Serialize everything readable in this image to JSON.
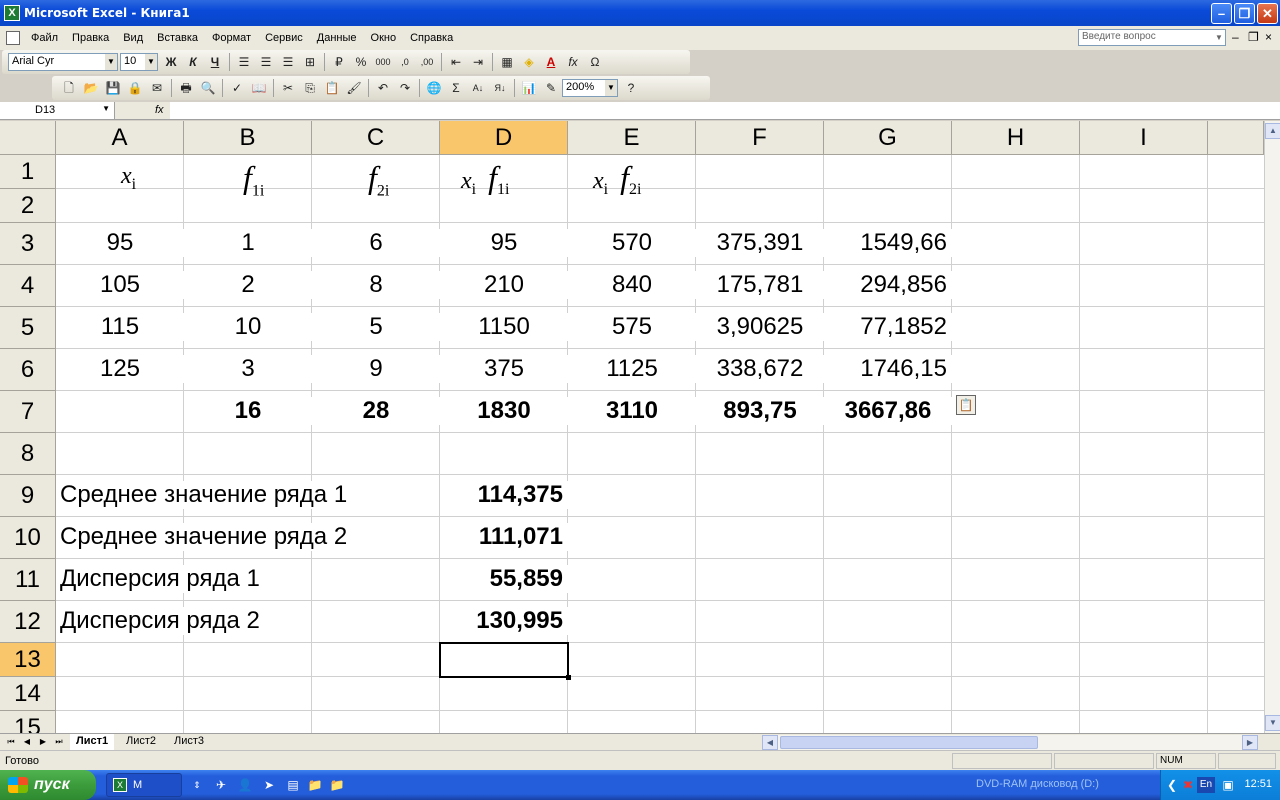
{
  "window": {
    "title": "Microsoft Excel - Книга1"
  },
  "menu": {
    "items": [
      "Файл",
      "Правка",
      "Вид",
      "Вставка",
      "Формат",
      "Сервис",
      "Данные",
      "Окно",
      "Справка"
    ],
    "ask_placeholder": "Введите вопрос"
  },
  "format_toolbar": {
    "font": "Arial Cyr",
    "size": "10",
    "bold": "Ж",
    "italic": "К",
    "underline": "Ч"
  },
  "standard_toolbar": {
    "zoom": "200%"
  },
  "formula_bar": {
    "name_box": "D13",
    "fx": "fx",
    "content": ""
  },
  "columns": [
    "A",
    "B",
    "C",
    "D",
    "E",
    "F",
    "G",
    "H",
    "I"
  ],
  "rows": [
    "1",
    "2",
    "3",
    "4",
    "5",
    "6",
    "7",
    "8",
    "9",
    "10",
    "11",
    "12",
    "13",
    "14",
    "15"
  ],
  "selected_cell": "D13",
  "header_formulas": {
    "a": {
      "var": "x",
      "sub": "i"
    },
    "b": {
      "var": "f",
      "sub": "1i"
    },
    "c": {
      "var": "f",
      "sub": "2i"
    },
    "d": {
      "var1": "x",
      "sub1": "i",
      "var2": "f",
      "sub2": "1i"
    },
    "e": {
      "var1": "x",
      "sub1": "i",
      "var2": "f",
      "sub2": "2i"
    }
  },
  "table": {
    "rows": [
      {
        "A": "95",
        "B": "1",
        "C": "6",
        "D": "95",
        "E": "570",
        "F": "375,391",
        "G": "1549,66"
      },
      {
        "A": "105",
        "B": "2",
        "C": "8",
        "D": "210",
        "E": "840",
        "F": "175,781",
        "G": "294,856"
      },
      {
        "A": "115",
        "B": "10",
        "C": "5",
        "D": "1150",
        "E": "575",
        "F": "3,90625",
        "G": "77,1852"
      },
      {
        "A": "125",
        "B": "3",
        "C": "9",
        "D": "375",
        "E": "1125",
        "F": "338,672",
        "G": "1746,15"
      }
    ],
    "totals": {
      "B": "16",
      "C": "28",
      "D": "1830",
      "E": "3110",
      "F": "893,75",
      "G": "3667,86"
    }
  },
  "stats": [
    {
      "label": "Среднее значение ряда 1",
      "value": "114,375"
    },
    {
      "label": "Среднее значение ряда 2",
      "value": "111,071"
    },
    {
      "label": "Дисперсия ряда 1",
      "value": "55,859"
    },
    {
      "label": "Дисперсия ряда 2",
      "value": "130,995"
    }
  ],
  "sheets": [
    "Лист1",
    "Лист2",
    "Лист3"
  ],
  "status": {
    "text": "Готово",
    "num": "NUM"
  },
  "taskbar": {
    "start": "пуск",
    "task": "M",
    "tray_text": "DVD-RAM дисковод (D:)",
    "lang": "En",
    "time": "12:51"
  }
}
